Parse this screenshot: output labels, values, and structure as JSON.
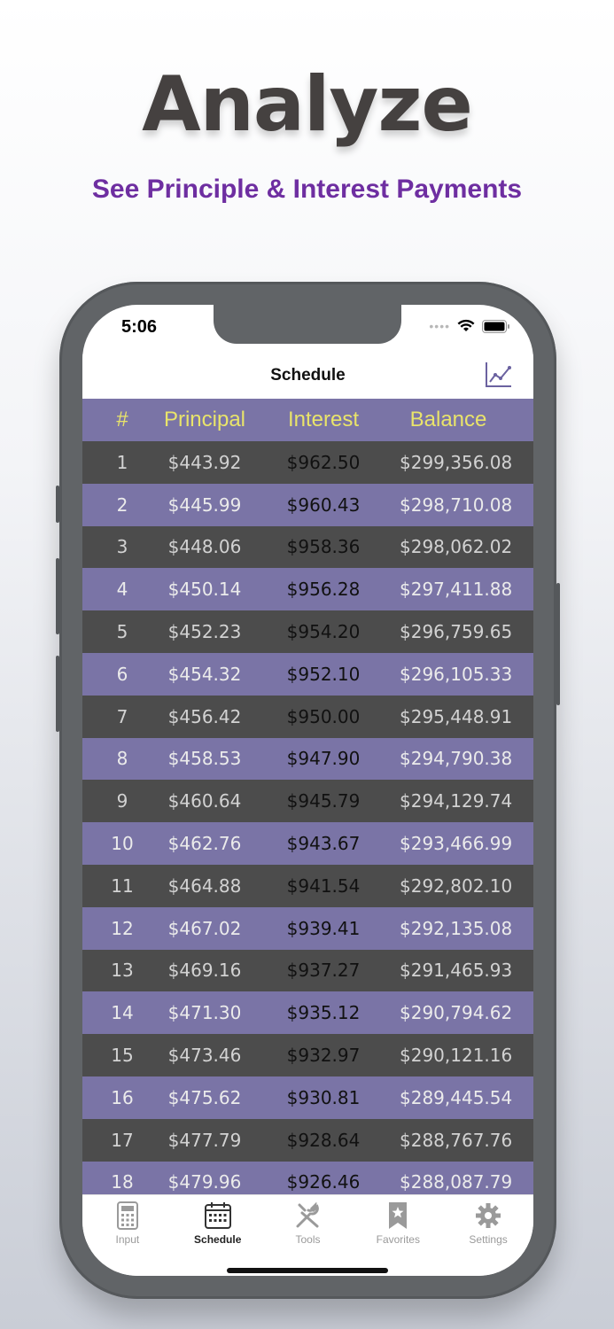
{
  "hero": {
    "title": "Analyze",
    "subtitle": "See Principle & Interest Payments"
  },
  "status_bar": {
    "time": "5:06"
  },
  "nav": {
    "title": "Schedule",
    "chart_icon": "chart-line-icon"
  },
  "table": {
    "headers": [
      "#",
      "Principal",
      "Interest",
      "Balance"
    ],
    "rows": [
      [
        "1",
        "$443.92",
        "$962.50",
        "$299,356.08"
      ],
      [
        "2",
        "$445.99",
        "$960.43",
        "$298,710.08"
      ],
      [
        "3",
        "$448.06",
        "$958.36",
        "$298,062.02"
      ],
      [
        "4",
        "$450.14",
        "$956.28",
        "$297,411.88"
      ],
      [
        "5",
        "$452.23",
        "$954.20",
        "$296,759.65"
      ],
      [
        "6",
        "$454.32",
        "$952.10",
        "$296,105.33"
      ],
      [
        "7",
        "$456.42",
        "$950.00",
        "$295,448.91"
      ],
      [
        "8",
        "$458.53",
        "$947.90",
        "$294,790.38"
      ],
      [
        "9",
        "$460.64",
        "$945.79",
        "$294,129.74"
      ],
      [
        "10",
        "$462.76",
        "$943.67",
        "$293,466.99"
      ],
      [
        "11",
        "$464.88",
        "$941.54",
        "$292,802.10"
      ],
      [
        "12",
        "$467.02",
        "$939.41",
        "$292,135.08"
      ],
      [
        "13",
        "$469.16",
        "$937.27",
        "$291,465.93"
      ],
      [
        "14",
        "$471.30",
        "$935.12",
        "$290,794.62"
      ],
      [
        "15",
        "$473.46",
        "$932.97",
        "$290,121.16"
      ],
      [
        "16",
        "$475.62",
        "$930.81",
        "$289,445.54"
      ],
      [
        "17",
        "$477.79",
        "$928.64",
        "$288,767.76"
      ],
      [
        "18",
        "$479.96",
        "$926.46",
        "$288,087.79"
      ]
    ]
  },
  "tabs": [
    {
      "label": "Input",
      "icon": "calculator-icon"
    },
    {
      "label": "Schedule",
      "icon": "calendar-icon",
      "active": true
    },
    {
      "label": "Tools",
      "icon": "tools-icon"
    },
    {
      "label": "Favorites",
      "icon": "bookmark-icon"
    },
    {
      "label": "Settings",
      "icon": "gear-icon"
    }
  ],
  "colors": {
    "accent_purple": "#6e2ea1",
    "row_light": "#7a74a6",
    "row_dark": "#4c4c4c",
    "header_text": "#e9e46a"
  }
}
